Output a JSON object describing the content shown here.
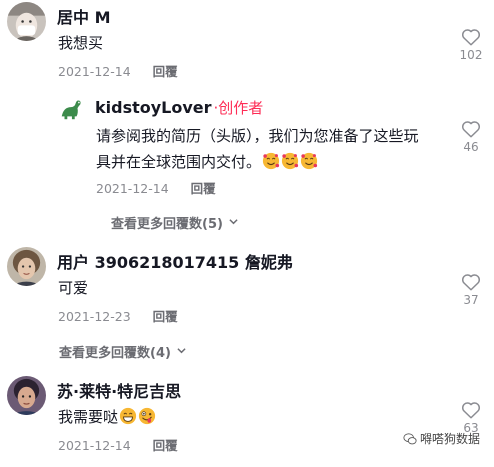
{
  "comments": [
    {
      "username": "居中 M",
      "text": "我想买",
      "date": "2021-12-14",
      "reply_label": "回覆",
      "likes": "102"
    },
    {
      "username": "kidstoyLover",
      "author_tag": "·创作者",
      "text_line1": "请参阅我的简历（头版），我们为您准备了这些玩",
      "text_line2": "具并在全球范围内交付。",
      "date": "2021-12-14",
      "reply_label": "回覆",
      "likes": "46"
    },
    {
      "username": "用户 3906218017415 詹妮弗",
      "text": "可爱",
      "date": "2021-12-23",
      "reply_label": "回覆",
      "likes": "37"
    },
    {
      "username": "苏·莱特·特尼吉思",
      "text": "我需要哒",
      "date": "2021-12-14",
      "reply_label": "回覆",
      "likes": "63"
    }
  ],
  "more_replies_1": "查看更多回覆数(5)",
  "more_replies_2": "查看更多回覆数(4)",
  "watermark": "嘚嗒狗数据",
  "colors": {
    "author_tag": "#fe2c55",
    "meta": "#8a8b91",
    "text": "#161823"
  },
  "icons": [
    "heart-icon",
    "chevron-down-icon",
    "smiling-hearts-emoji",
    "grinning-emoji",
    "zany-emoji"
  ]
}
